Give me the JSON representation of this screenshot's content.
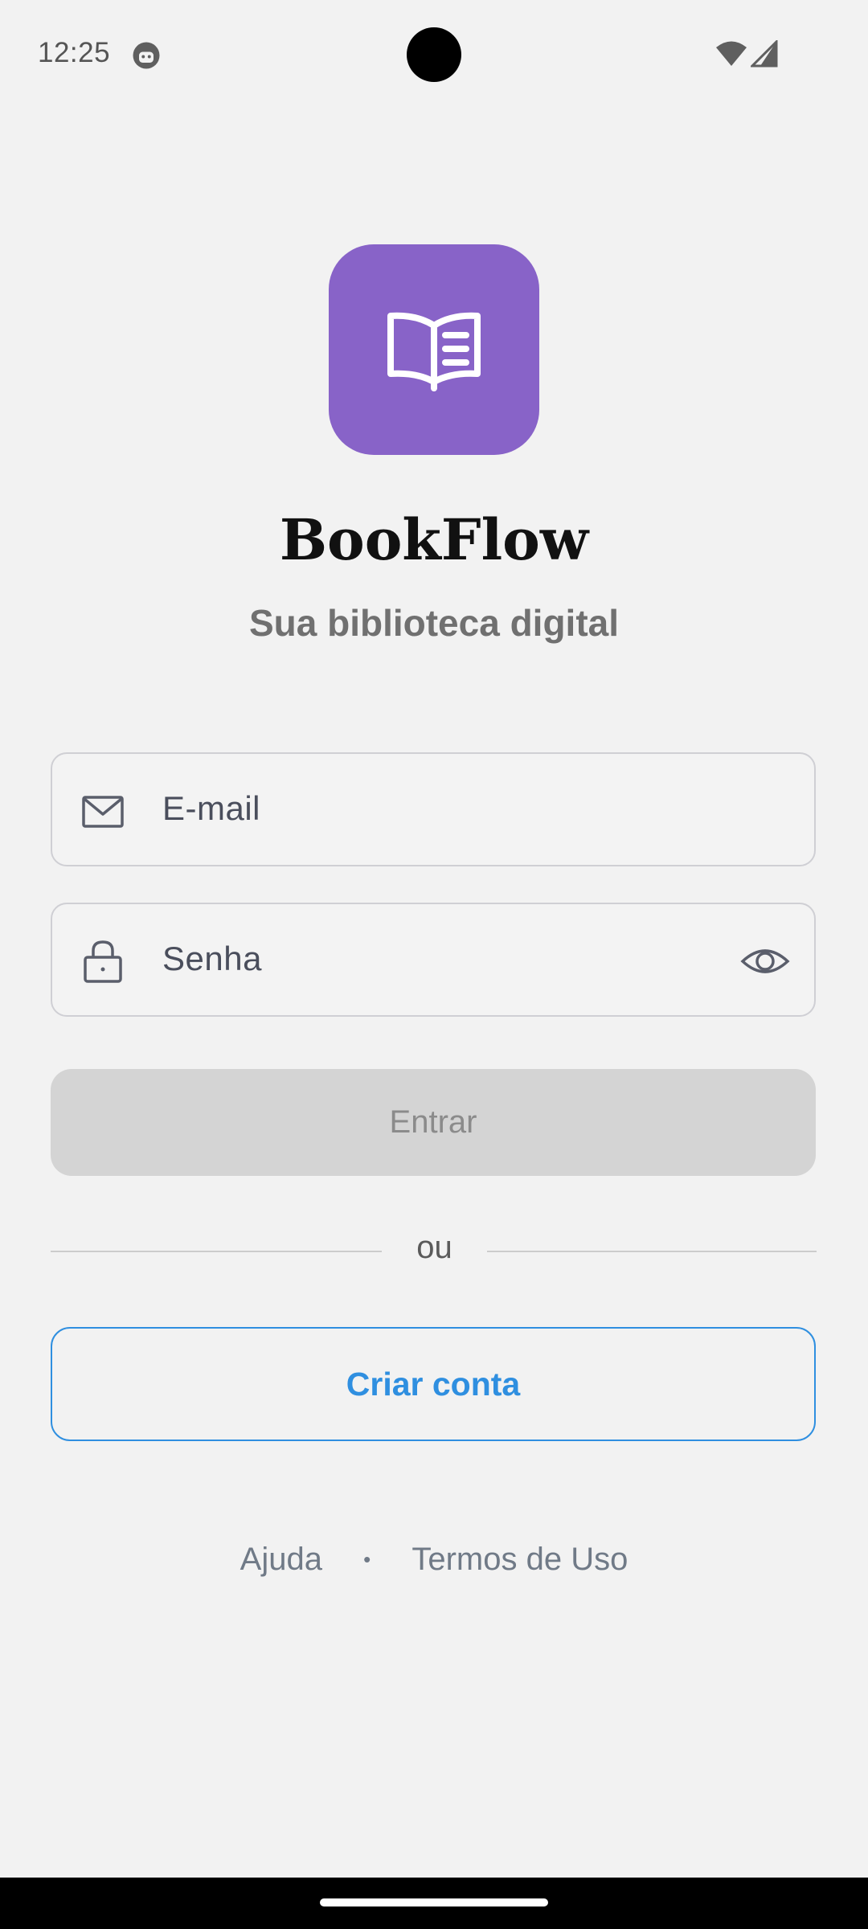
{
  "status_bar": {
    "time": "12:25"
  },
  "app": {
    "name": "BookFlow",
    "tagline": "Sua biblioteca digital",
    "brand_color": "#8863c8",
    "logo_icon": "open-book-icon"
  },
  "form": {
    "email": {
      "placeholder": "E-mail",
      "value": "",
      "icon": "envelope-icon"
    },
    "password": {
      "placeholder": "Senha",
      "value": "",
      "icon": "lock-icon",
      "toggle_icon": "eye-icon"
    },
    "login_label": "Entrar",
    "divider_label": "ou",
    "create_account_label": "Criar conta",
    "accent_color": "#2f8fe0"
  },
  "footer": {
    "help_label": "Ajuda",
    "separator": "•",
    "terms_label": "Termos de Uso"
  }
}
